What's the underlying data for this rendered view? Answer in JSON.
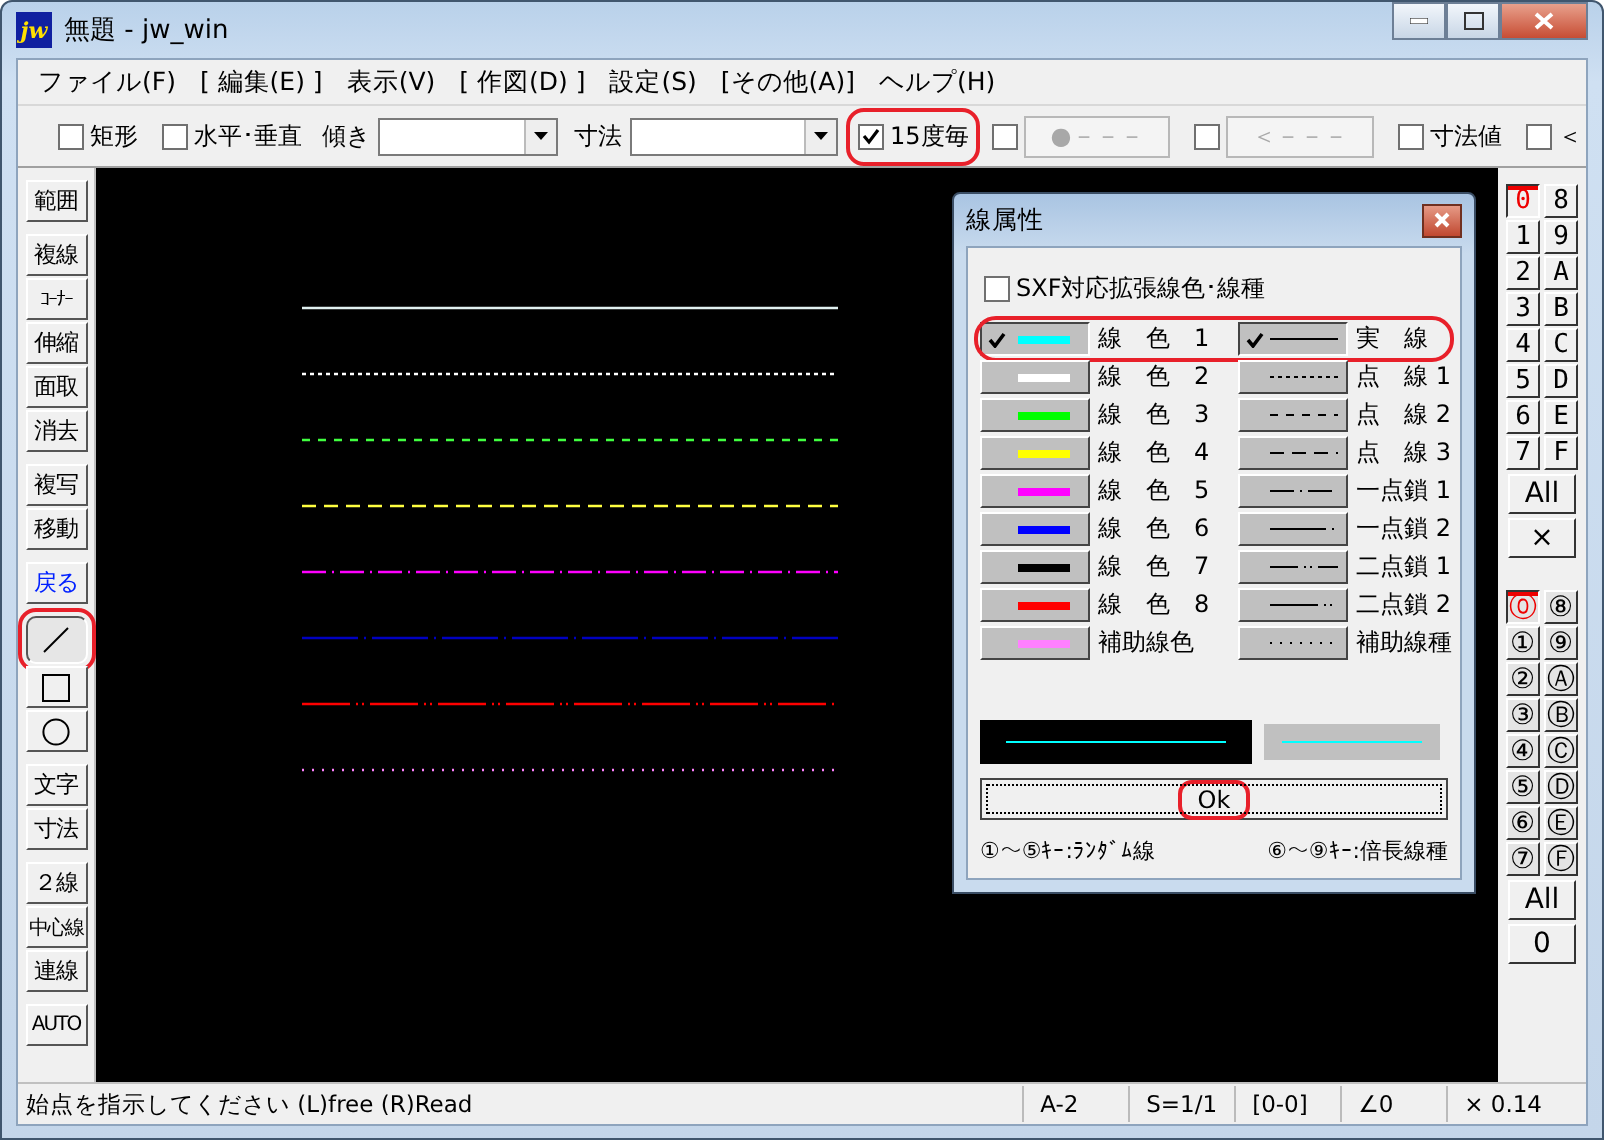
{
  "window": {
    "icon_text": "jw",
    "title": "無題 - jw_win"
  },
  "menu": [
    {
      "label": "ファイル(F)"
    },
    {
      "label": "[ 編集(E) ]"
    },
    {
      "label": "表示(V)"
    },
    {
      "label": "[ 作図(D) ]"
    },
    {
      "label": "設定(S)"
    },
    {
      "label": "[その他(A)]"
    },
    {
      "label": "ヘルプ(H)"
    }
  ],
  "toolbar": [
    {
      "kind": "checkbox",
      "label": "矩形",
      "checked": false,
      "disabled": false,
      "highlighted": false
    },
    {
      "kind": "checkbox",
      "label": "水平･垂直",
      "checked": false,
      "disabled": false,
      "highlighted": false
    },
    {
      "kind": "combo",
      "label": "傾き"
    },
    {
      "kind": "combo",
      "label": "寸法"
    },
    {
      "kind": "checkbox",
      "label": "15度毎",
      "checked": true,
      "disabled": false,
      "highlighted": true
    },
    {
      "kind": "check-button",
      "label": "●－－－",
      "checked": false,
      "disabled": true,
      "highlighted": false
    },
    {
      "kind": "check-button",
      "label": "＜－－－",
      "checked": false,
      "disabled": true,
      "highlighted": false
    },
    {
      "kind": "checkbox",
      "label": "寸法値",
      "checked": false,
      "disabled": false,
      "highlighted": false
    },
    {
      "kind": "checkbox",
      "label": "＜",
      "checked": false,
      "disabled": false,
      "highlighted": false
    }
  ],
  "tools": [
    [
      {
        "kind": "text",
        "label": "範囲",
        "selected": false
      }
    ],
    [
      {
        "kind": "text",
        "label": "複線",
        "selected": false
      },
      {
        "kind": "text",
        "label": "ｺｰﾅｰ",
        "selected": false
      },
      {
        "kind": "text",
        "label": "伸縮",
        "selected": false
      },
      {
        "kind": "text",
        "label": "面取",
        "selected": false
      },
      {
        "kind": "text",
        "label": "消去",
        "selected": false
      }
    ],
    [
      {
        "kind": "text",
        "label": "複写",
        "selected": false
      },
      {
        "kind": "text",
        "label": "移動",
        "selected": false
      }
    ],
    [
      {
        "kind": "undo",
        "label": "戻る",
        "selected": false
      }
    ],
    [
      {
        "kind": "line",
        "selected": true,
        "highlighted": true
      },
      {
        "kind": "rect",
        "selected": false
      },
      {
        "kind": "circle",
        "selected": false
      }
    ],
    [
      {
        "kind": "text",
        "label": "文字",
        "selected": false
      },
      {
        "kind": "text",
        "label": "寸法",
        "selected": false
      }
    ],
    [
      {
        "kind": "text",
        "label": "２線",
        "selected": false
      },
      {
        "kind": "text",
        "label": "中心線",
        "selected": false
      },
      {
        "kind": "text",
        "label": "連線",
        "selected": false
      }
    ],
    [
      {
        "kind": "text",
        "label": "AUTO",
        "selected": false
      }
    ]
  ],
  "canvas": {
    "lines": [
      {
        "color": "#e0f0f0",
        "kind": "solid"
      },
      {
        "color": "#ffffff",
        "kind": "dot1"
      },
      {
        "color": "#40ff40",
        "kind": "dot2"
      },
      {
        "color": "#ffff40",
        "kind": "dot3"
      },
      {
        "color": "#ff00ff",
        "kind": "chain1"
      },
      {
        "color": "#0000c0",
        "kind": "chain2"
      },
      {
        "color": "#ff0000",
        "kind": "dchain2"
      },
      {
        "color": "#ff80ff",
        "kind": "aux"
      }
    ]
  },
  "dialog": {
    "title": "線属性",
    "sxf_option": {
      "label": "SXF対応拡張線色･線種",
      "checked": false
    },
    "colors": [
      {
        "label": "線　色　1",
        "color": "#00ffff",
        "selected": true,
        "highlighted": true
      },
      {
        "label": "線　色　2",
        "color": "#ffffff",
        "selected": false,
        "highlighted": false
      },
      {
        "label": "線　色　3",
        "color": "#00ff00",
        "selected": false,
        "highlighted": false
      },
      {
        "label": "線　色　4",
        "color": "#ffff00",
        "selected": false,
        "highlighted": false
      },
      {
        "label": "線　色　5",
        "color": "#ff00ff",
        "selected": false,
        "highlighted": false
      },
      {
        "label": "線　色　6",
        "color": "#0000ff",
        "selected": false,
        "highlighted": false
      },
      {
        "label": "線　色　7",
        "color": "#000000",
        "selected": false,
        "highlighted": false
      },
      {
        "label": "線　色　8",
        "color": "#ff0000",
        "selected": false,
        "highlighted": false
      },
      {
        "label": "補助線色",
        "color": "#ff80ff",
        "selected": false,
        "highlighted": false
      }
    ],
    "types": [
      {
        "label": "実　線",
        "kind": "solid",
        "selected": true
      },
      {
        "label": "点　線 1",
        "kind": "dot1",
        "selected": false
      },
      {
        "label": "点　線 2",
        "kind": "dot2",
        "selected": false
      },
      {
        "label": "点　線 3",
        "kind": "dot3",
        "selected": false
      },
      {
        "label": "一点鎖 1",
        "kind": "chain1",
        "selected": false
      },
      {
        "label": "一点鎖 2",
        "kind": "chain2",
        "selected": false
      },
      {
        "label": "二点鎖 1",
        "kind": "dchain1",
        "selected": false
      },
      {
        "label": "二点鎖 2",
        "kind": "dchain2",
        "selected": false
      },
      {
        "label": "補助線種",
        "kind": "aux",
        "selected": false
      }
    ],
    "ok_button": {
      "label": "Ok",
      "highlighted": true
    },
    "hints": [
      "①～⑤ｷｰ:ﾗﾝﾀﾞﾑ線",
      "⑥～⑨ｷｰ:倍長線種"
    ]
  },
  "layer_groups": {
    "items": [
      {
        "label": "0",
        "selected": true
      },
      {
        "label": "8",
        "selected": false
      },
      {
        "label": "1",
        "selected": false
      },
      {
        "label": "9",
        "selected": false
      },
      {
        "label": "2",
        "selected": false
      },
      {
        "label": "A",
        "selected": false
      },
      {
        "label": "3",
        "selected": false
      },
      {
        "label": "B",
        "selected": false
      },
      {
        "label": "4",
        "selected": false
      },
      {
        "label": "C",
        "selected": false
      },
      {
        "label": "5",
        "selected": false
      },
      {
        "label": "D",
        "selected": false
      },
      {
        "label": "6",
        "selected": false
      },
      {
        "label": "E",
        "selected": false
      },
      {
        "label": "7",
        "selected": false
      },
      {
        "label": "F",
        "selected": false
      }
    ],
    "buttons": [
      "All",
      "×"
    ]
  },
  "layers": {
    "items": [
      {
        "label": "⓪",
        "selected": true
      },
      {
        "label": "⑧",
        "selected": false
      },
      {
        "label": "①",
        "selected": false
      },
      {
        "label": "⑨",
        "selected": false
      },
      {
        "label": "②",
        "selected": false
      },
      {
        "label": "Ⓐ",
        "selected": false
      },
      {
        "label": "③",
        "selected": false
      },
      {
        "label": "Ⓑ",
        "selected": false
      },
      {
        "label": "④",
        "selected": false
      },
      {
        "label": "Ⓒ",
        "selected": false
      },
      {
        "label": "⑤",
        "selected": false
      },
      {
        "label": "Ⓓ",
        "selected": false
      },
      {
        "label": "⑥",
        "selected": false
      },
      {
        "label": "Ⓔ",
        "selected": false
      },
      {
        "label": "⑦",
        "selected": false
      },
      {
        "label": "Ⓕ",
        "selected": false
      }
    ],
    "buttons": [
      "All",
      "0"
    ]
  },
  "status_bar": {
    "message": "始点を指示してください (L)free (R)Read",
    "fields": [
      "A-2",
      "S=1/1",
      "[0-0]",
      "∠0",
      "× 0.14"
    ]
  }
}
